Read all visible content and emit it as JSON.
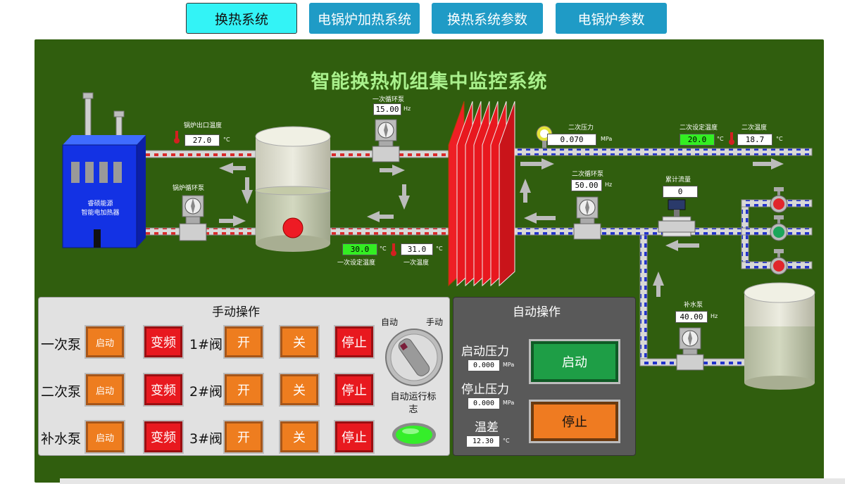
{
  "tabs": [
    {
      "label": "换热系统",
      "active": true
    },
    {
      "label": "电锅炉加热系统",
      "active": false
    },
    {
      "label": "换热系统参数",
      "active": false
    },
    {
      "label": "电锅炉参数",
      "active": false
    }
  ],
  "scene": {
    "title": "智能换热机组集中监控系统",
    "boiler": {
      "line1": "睿硕能源",
      "line2": "智能电加热器"
    },
    "boiler_outlet_temp": {
      "label": "锅炉出口温度",
      "value": "27.0",
      "unit": "°C"
    },
    "boiler_pump": {
      "label": "锅炉循环泵"
    },
    "primary_pump": {
      "label": "一次循环泵",
      "value": "15.00",
      "unit": "Hz"
    },
    "primary_set_temp": {
      "label": "一次设定温度",
      "value": "30.0",
      "unit": "°C"
    },
    "primary_temp": {
      "label": "一次温度",
      "value": "31.0",
      "unit": "°C"
    },
    "secondary_pressure": {
      "label": "二次压力",
      "value": "0.070",
      "unit": "MPa"
    },
    "secondary_set_temp": {
      "label": "二次设定温度",
      "value": "20.0",
      "unit": "°C"
    },
    "secondary_temp": {
      "label": "二次温度",
      "value": "18.7",
      "unit": "°C"
    },
    "secondary_pump": {
      "label": "二次循环泵",
      "value": "50.00",
      "unit": "Hz"
    },
    "flow_total": {
      "label": "累计流量",
      "value": "0"
    },
    "makeup_pump": {
      "label": "补水泵",
      "value": "40.00",
      "unit": "Hz"
    }
  },
  "manual": {
    "title": "手动操作",
    "rows": [
      {
        "pump": "一次泵",
        "start": "启动",
        "vfd": "变频",
        "valve": "1#阀",
        "open": "开",
        "close": "关",
        "stop": "停止"
      },
      {
        "pump": "二次泵",
        "start": "启动",
        "vfd": "变频",
        "valve": "2#阀",
        "open": "开",
        "close": "关",
        "stop": "停止"
      },
      {
        "pump": "补水泵",
        "start": "启动",
        "vfd": "变频",
        "valve": "3#阀",
        "open": "开",
        "close": "关",
        "stop": "停止"
      }
    ],
    "knob_auto": "自动",
    "knob_manual": "手动",
    "run_flag_label": "自动运行标志"
  },
  "auto": {
    "title": "自动操作",
    "start_pressure": {
      "label": "启动压力",
      "value": "0.000",
      "unit": "MPa"
    },
    "stop_pressure": {
      "label": "停止压力",
      "value": "0.000",
      "unit": "MPa"
    },
    "temp_diff": {
      "label": "温差",
      "value": "12.30",
      "unit": "°C"
    },
    "start_button": "启动",
    "stop_button": "停止"
  },
  "colors": {
    "background": "#305e0e",
    "tab": "#1f9bc6",
    "tab_active": "#33f3f6",
    "hot_pipe": "#d92a2a",
    "cold_pipe": "#2233cc",
    "title": "#a9f08c"
  }
}
